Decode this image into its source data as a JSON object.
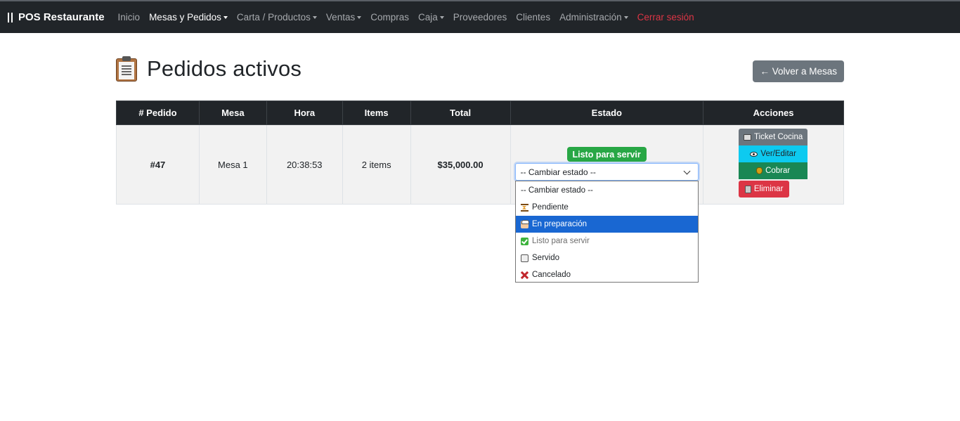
{
  "navbar": {
    "brand": "POS Restaurante",
    "items": [
      {
        "label": "Inicio",
        "dropdown": false
      },
      {
        "label": "Mesas y Pedidos",
        "dropdown": true
      },
      {
        "label": "Carta / Productos",
        "dropdown": true
      },
      {
        "label": "Ventas",
        "dropdown": true
      },
      {
        "label": "Compras",
        "dropdown": false
      },
      {
        "label": "Caja",
        "dropdown": true
      },
      {
        "label": "Proveedores",
        "dropdown": false
      },
      {
        "label": "Clientes",
        "dropdown": false
      },
      {
        "label": "Administración",
        "dropdown": true
      },
      {
        "label": "Cerrar sesión",
        "dropdown": false
      }
    ]
  },
  "header": {
    "title": "Pedidos activos",
    "back_button": "← Volver a Mesas"
  },
  "table": {
    "columns": [
      "# Pedido",
      "Mesa",
      "Hora",
      "Items",
      "Total",
      "Estado",
      "Acciones"
    ],
    "rows": [
      {
        "pedido": "#47",
        "mesa": "Mesa 1",
        "hora": "20:38:53",
        "items": "2 items",
        "total": "$35,000.00",
        "estado_badge": "Listo para servir",
        "estado_select": "-- Cambiar estado --",
        "actions": {
          "ticket": "Ticket Cocina",
          "ver": "Ver/Editar",
          "cobrar": "Cobrar",
          "eliminar": "Eliminar"
        }
      }
    ]
  },
  "status_dropdown": {
    "options": [
      {
        "label": "-- Cambiar estado --",
        "icon": "none"
      },
      {
        "label": "Pendiente",
        "icon": "hourglass-icon"
      },
      {
        "label": "En preparación",
        "icon": "chef-icon"
      },
      {
        "label": "Listo para servir",
        "icon": "check-icon"
      },
      {
        "label": "Servido",
        "icon": "tray-icon"
      },
      {
        "label": "Cancelado",
        "icon": "x-icon"
      }
    ],
    "highlighted": "En preparación",
    "disabled": "Listo para servir"
  },
  "colors": {
    "navbar_bg": "#212529",
    "success": "#28a745",
    "info": "#0dcaf0",
    "danger": "#dc3545",
    "secondary": "#6c757d",
    "highlight": "#1967d2"
  }
}
